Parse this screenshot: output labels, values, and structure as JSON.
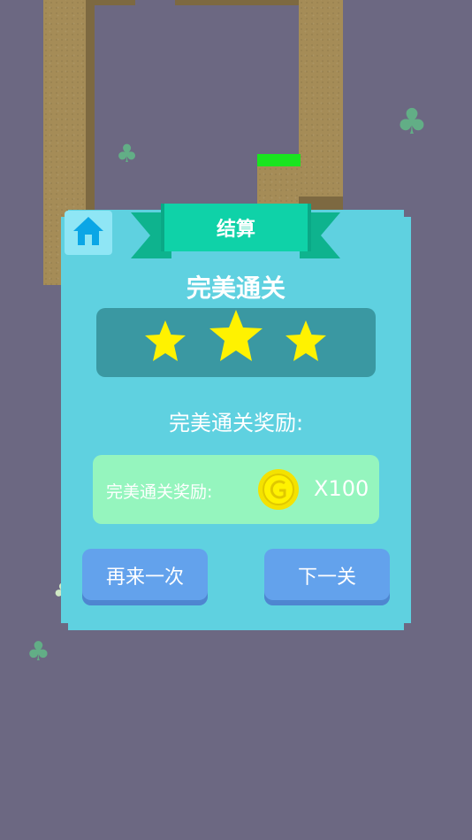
{
  "scene": {
    "background_color": "#6c6882",
    "pillar_color": "#a58c57",
    "grass_color": "#19e51f",
    "decorations": [
      "clover-icon",
      "clover-icon",
      "clover-icon",
      "clover-icon"
    ]
  },
  "result_panel": {
    "header_title": "结算",
    "home_icon": "home-icon",
    "title": "完美通关",
    "stars_earned": 3,
    "stars_total": 3,
    "reward_heading": "完美通关奖励:",
    "reward": {
      "label": "完美通关奖励:",
      "coin_icon": "coin-icon",
      "amount": "X100"
    },
    "buttons": {
      "retry_label": "再来一次",
      "next_label": "下一关"
    },
    "colors": {
      "panel": "#5fd1e0",
      "ribbon": "#0fd2a8",
      "star": "#fff200",
      "star_bar": "#3a98a2",
      "reward_box": "#95f5be",
      "button": "#63a2ec"
    }
  }
}
